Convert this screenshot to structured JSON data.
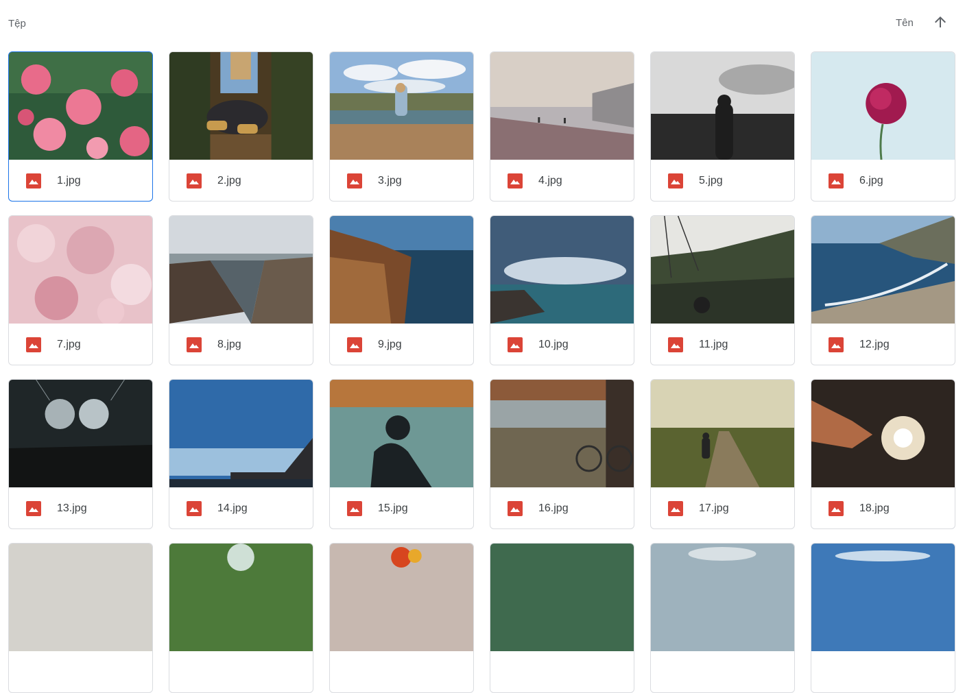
{
  "header": {
    "section_title": "Tệp",
    "sort_label": "Tên",
    "sort_icon": "arrow-upward-icon"
  },
  "file_icon": {
    "name": "image-file-icon",
    "color": "#db4437"
  },
  "accent_color": "#1a73e8",
  "files": [
    {
      "name": "1.jpg"
    },
    {
      "name": "2.jpg"
    },
    {
      "name": "3.jpg"
    },
    {
      "name": "4.jpg"
    },
    {
      "name": "5.jpg"
    },
    {
      "name": "6.jpg"
    },
    {
      "name": "7.jpg"
    },
    {
      "name": "8.jpg"
    },
    {
      "name": "9.jpg"
    },
    {
      "name": "10.jpg"
    },
    {
      "name": "11.jpg"
    },
    {
      "name": "12.jpg"
    },
    {
      "name": "13.jpg"
    },
    {
      "name": "14.jpg"
    },
    {
      "name": "15.jpg"
    },
    {
      "name": "16.jpg"
    },
    {
      "name": "17.jpg"
    },
    {
      "name": "18.jpg"
    },
    {
      "name": ""
    },
    {
      "name": ""
    },
    {
      "name": ""
    },
    {
      "name": ""
    },
    {
      "name": ""
    },
    {
      "name": ""
    }
  ]
}
